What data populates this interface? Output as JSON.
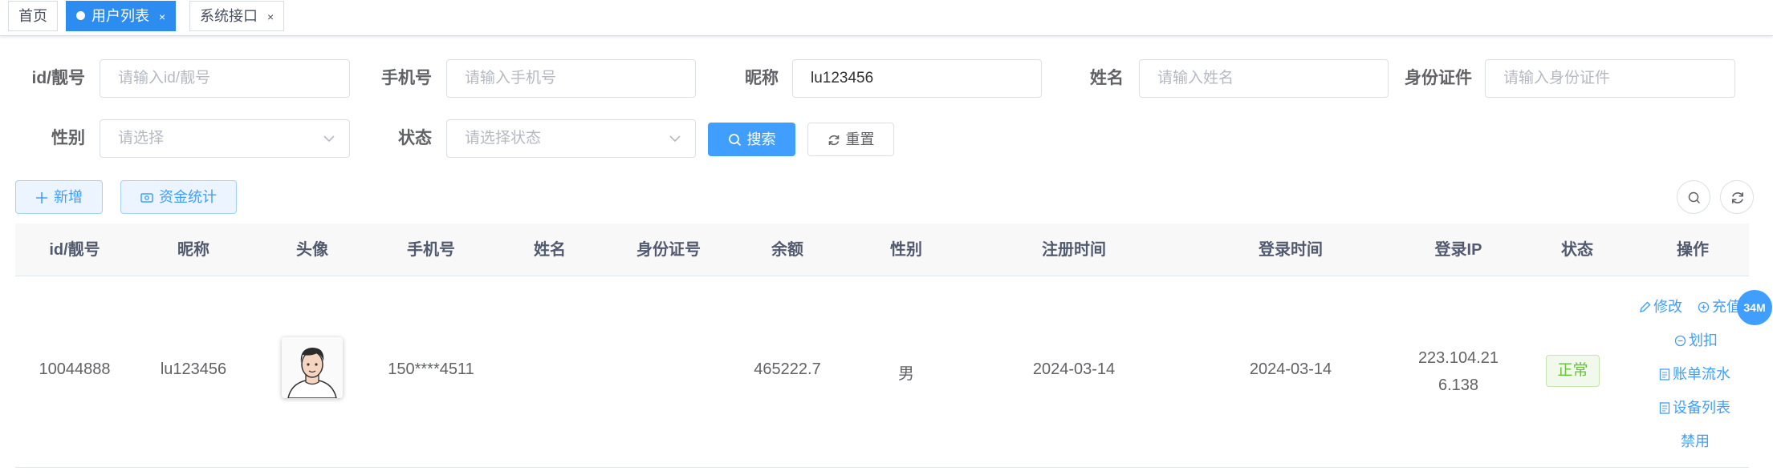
{
  "tabs": [
    {
      "label": "首页"
    },
    {
      "label": "用户列表",
      "active": true
    },
    {
      "label": "系统接口"
    }
  ],
  "tab_close": "×",
  "search": {
    "id_label": "id/靓号",
    "id_placeholder": "请输入id/靓号",
    "phone_label": "手机号",
    "phone_placeholder": "请输入手机号",
    "nickname_label": "昵称",
    "nickname_value": "lu123456",
    "name_label": "姓名",
    "name_placeholder": "请输入姓名",
    "idcard_label": "身份证件",
    "idcard_placeholder": "请输入身份证件",
    "gender_label": "性别",
    "gender_placeholder": "请选择",
    "status_label": "状态",
    "status_placeholder": "请选择状态",
    "search_button": "搜索",
    "reset_button": "重置"
  },
  "toolbar": {
    "add_button": "新增",
    "stats_button": "资金统计"
  },
  "table": {
    "columns": [
      "id/靓号",
      "昵称",
      "头像",
      "手机号",
      "姓名",
      "身份证号",
      "余额",
      "性别",
      "注册时间",
      "登录时间",
      "登录IP",
      "状态",
      "操作"
    ],
    "rows": [
      {
        "id": "10044888",
        "nickname": "lu123456",
        "phone": "150****4511",
        "name": "",
        "idcard": "",
        "balance": "465222.7",
        "gender": "男",
        "register_time": "2024-03-14",
        "login_time": "2024-03-14",
        "login_ip_line1": "223.104.21",
        "login_ip_line2": "6.138",
        "status": "正常",
        "actions": {
          "edit": "修改",
          "recharge": "充值",
          "deduct": "划扣",
          "bill_flow": "账单流水",
          "device_list": "设备列表",
          "disable": "禁用"
        }
      }
    ]
  },
  "memory_badge": "34M",
  "colors": {
    "primary": "#409eff",
    "tab_active": "#2d8cf0",
    "success": "#67c23a"
  }
}
